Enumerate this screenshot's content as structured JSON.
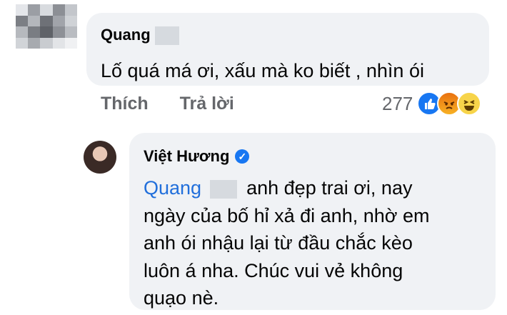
{
  "comment": {
    "author": "Quang",
    "text": "Lố quá má ơi, xấu mà ko biết , nhìn ói",
    "actions": {
      "like": "Thích",
      "reply": "Trả lời"
    },
    "reaction_count": "277",
    "reaction_icons": [
      "like-icon",
      "angry-icon",
      "haha-icon"
    ]
  },
  "reply": {
    "author": "Việt Hương",
    "mention": "Quang",
    "lines": [
      "anh đẹp trai ơi, nay",
      "ngày của bố hỉ xả đi anh, nhờ em",
      "anh ói nhậu lại từ đầu chắc kèo",
      "luôn á nha. Chúc vui vẻ không",
      "quạo nè."
    ]
  },
  "colors": {
    "bubble": "#f0f2f5",
    "link": "#216fdb",
    "accent": "#1877f2"
  }
}
